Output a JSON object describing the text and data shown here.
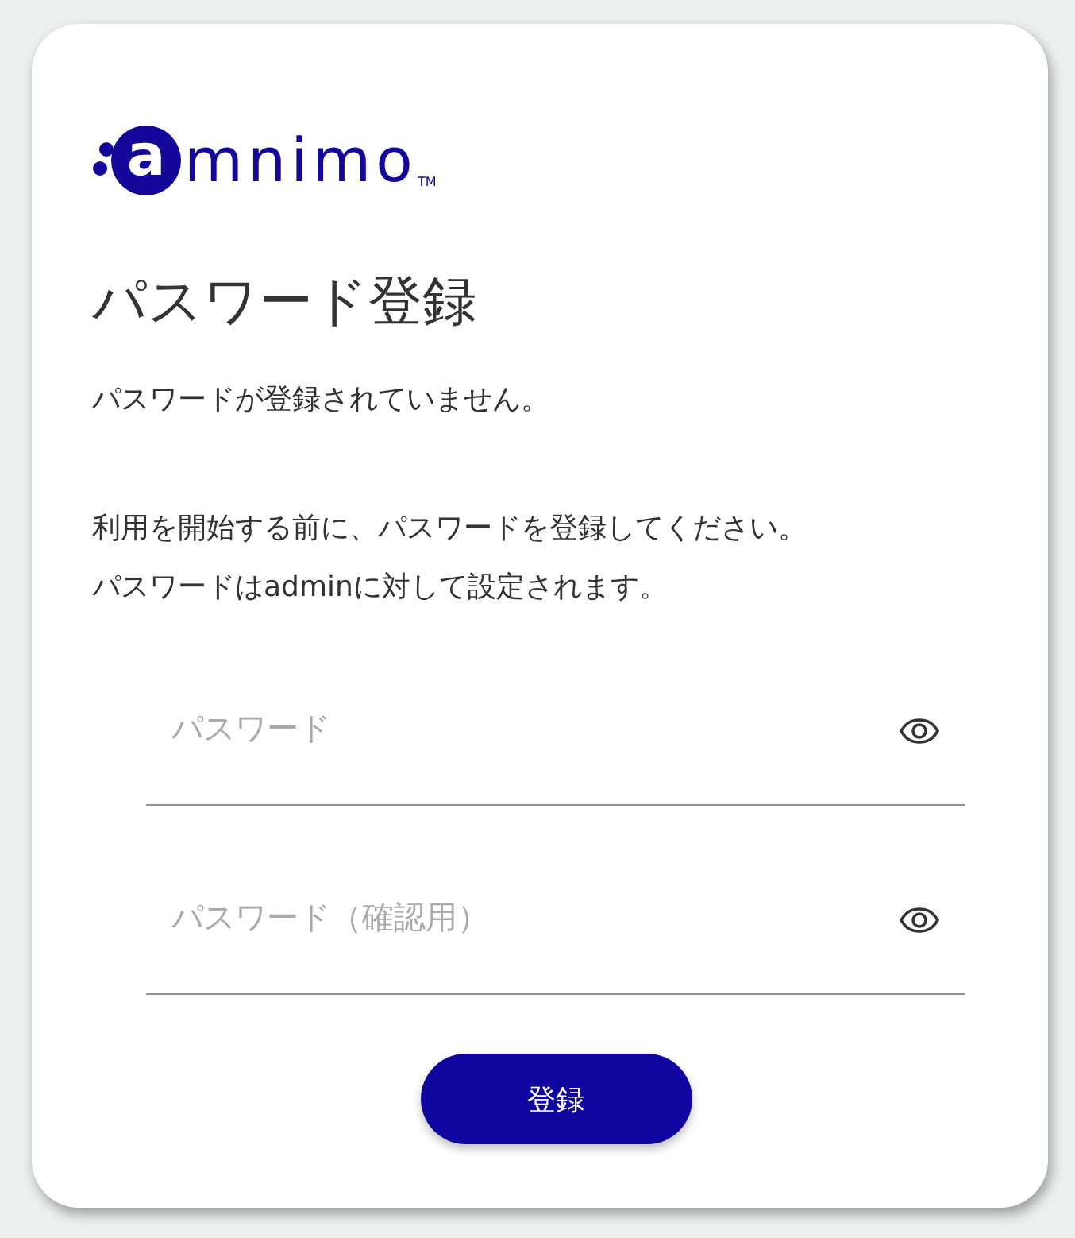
{
  "logo": {
    "mark": "a",
    "text": "mnimo",
    "tm": "TM"
  },
  "title": "パスワード登録",
  "messages": [
    "パスワードが登録されていません。",
    "利用を開始する前に、パスワードを登録してください。",
    "パスワードはadminに対して設定されます。"
  ],
  "fields": [
    {
      "placeholder": "パスワード"
    },
    {
      "placeholder": "パスワード（確認用）"
    }
  ],
  "submit": "登録"
}
